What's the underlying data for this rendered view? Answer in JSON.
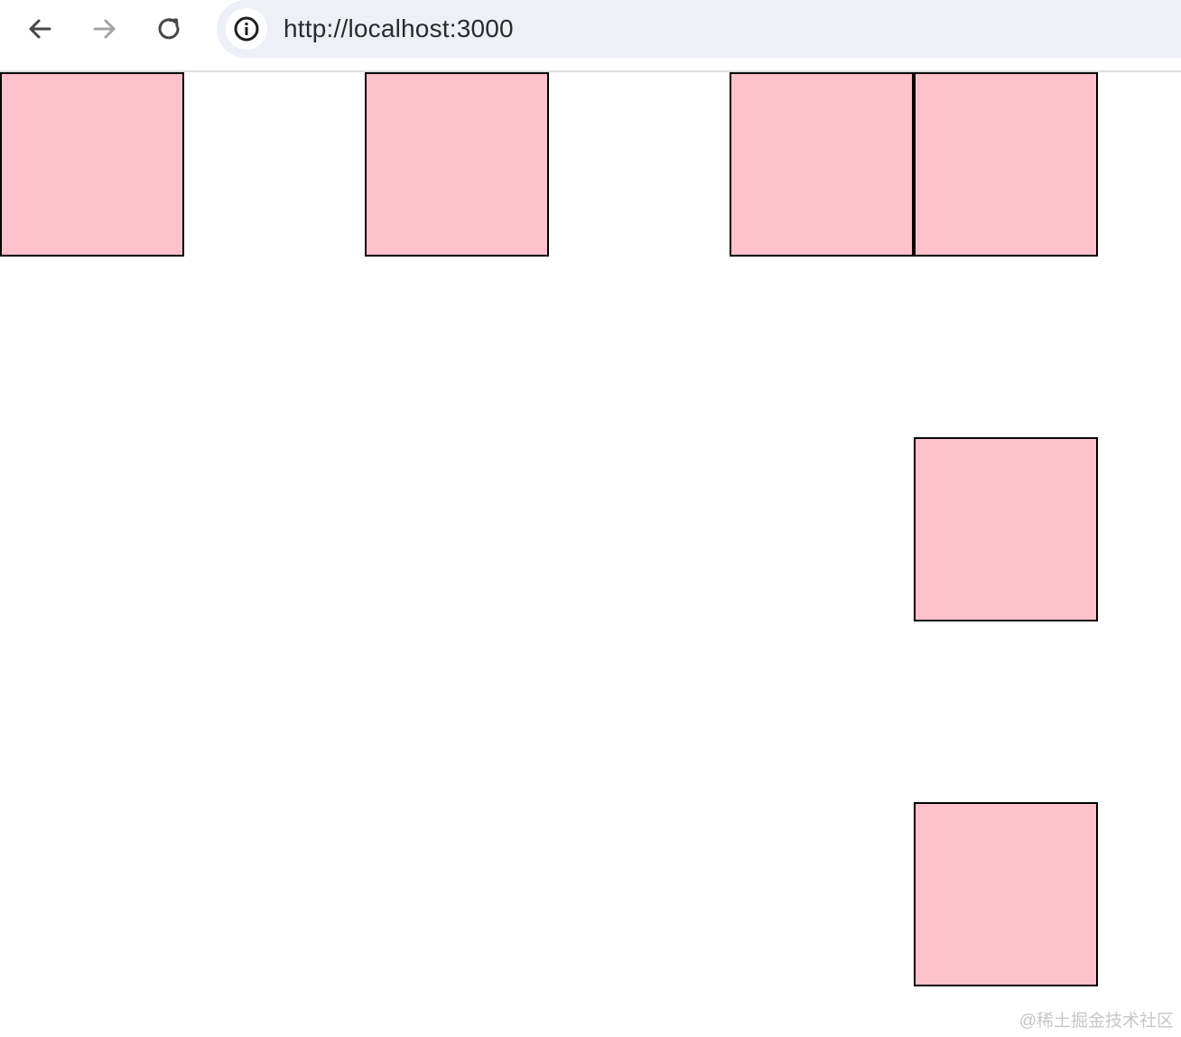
{
  "toolbar": {
    "url": "http://localhost:3000",
    "icons": {
      "back": "arrow-left-icon",
      "forward": "arrow-right-icon",
      "reload": "reload-icon",
      "site_info": "info-icon"
    },
    "forward_enabled": false
  },
  "page": {
    "box_fill": "#ffc1cc",
    "box_border": "#000000",
    "box_count": 6
  },
  "watermark": "@稀土掘金技术社区"
}
